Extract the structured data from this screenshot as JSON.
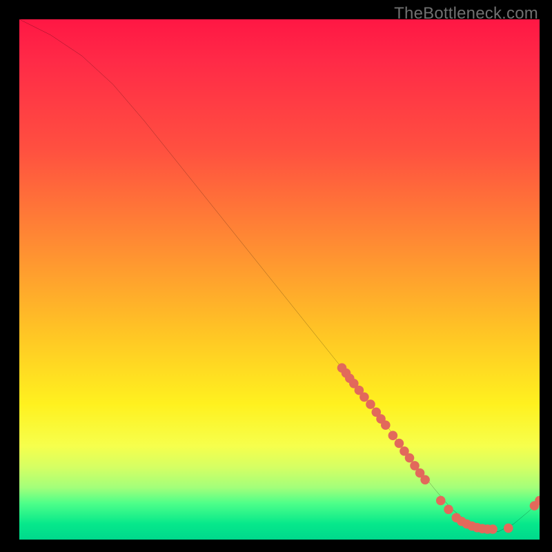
{
  "watermark": "TheBottleneck.com",
  "chart_data": {
    "type": "line",
    "title": "",
    "xlabel": "",
    "ylabel": "",
    "xlim": [
      0,
      100
    ],
    "ylim": [
      0,
      100
    ],
    "curve": {
      "x": [
        0,
        6,
        12,
        18,
        24,
        30,
        36,
        42,
        48,
        54,
        60,
        64,
        68,
        72,
        76,
        80,
        83,
        86,
        89,
        92,
        95,
        98,
        100
      ],
      "y": [
        100,
        97.0,
        93.0,
        87.5,
        80.5,
        73.0,
        65.5,
        58.0,
        50.5,
        43.0,
        35.5,
        30.5,
        25.5,
        20.0,
        14.5,
        9.5,
        6.0,
        3.5,
        2.0,
        1.5,
        3.0,
        5.5,
        7.5
      ]
    },
    "series": [
      {
        "name": "points-descent",
        "color": "#e2695b",
        "x": [
          62.0,
          62.8,
          63.5,
          64.3,
          65.3,
          66.3,
          67.5,
          68.6,
          69.5,
          70.4,
          71.8,
          73.0,
          74.0,
          75.0,
          76.0,
          77.0,
          78.0
        ],
        "y": [
          33.0,
          32.0,
          31.0,
          30.0,
          28.7,
          27.4,
          26.0,
          24.5,
          23.2,
          22.0,
          20.0,
          18.5,
          17.0,
          15.7,
          14.2,
          12.8,
          11.5
        ]
      },
      {
        "name": "points-valley",
        "color": "#e2695b",
        "x": [
          81.0,
          82.5,
          84.0,
          85.0,
          86.0,
          87.0,
          88.0,
          89.0,
          90.0,
          91.0,
          94.0
        ],
        "y": [
          7.5,
          5.8,
          4.2,
          3.5,
          3.0,
          2.6,
          2.3,
          2.1,
          2.0,
          2.0,
          2.2
        ]
      },
      {
        "name": "points-rise",
        "color": "#e2695b",
        "x": [
          99.0,
          100.0
        ],
        "y": [
          6.5,
          7.5
        ]
      }
    ]
  }
}
